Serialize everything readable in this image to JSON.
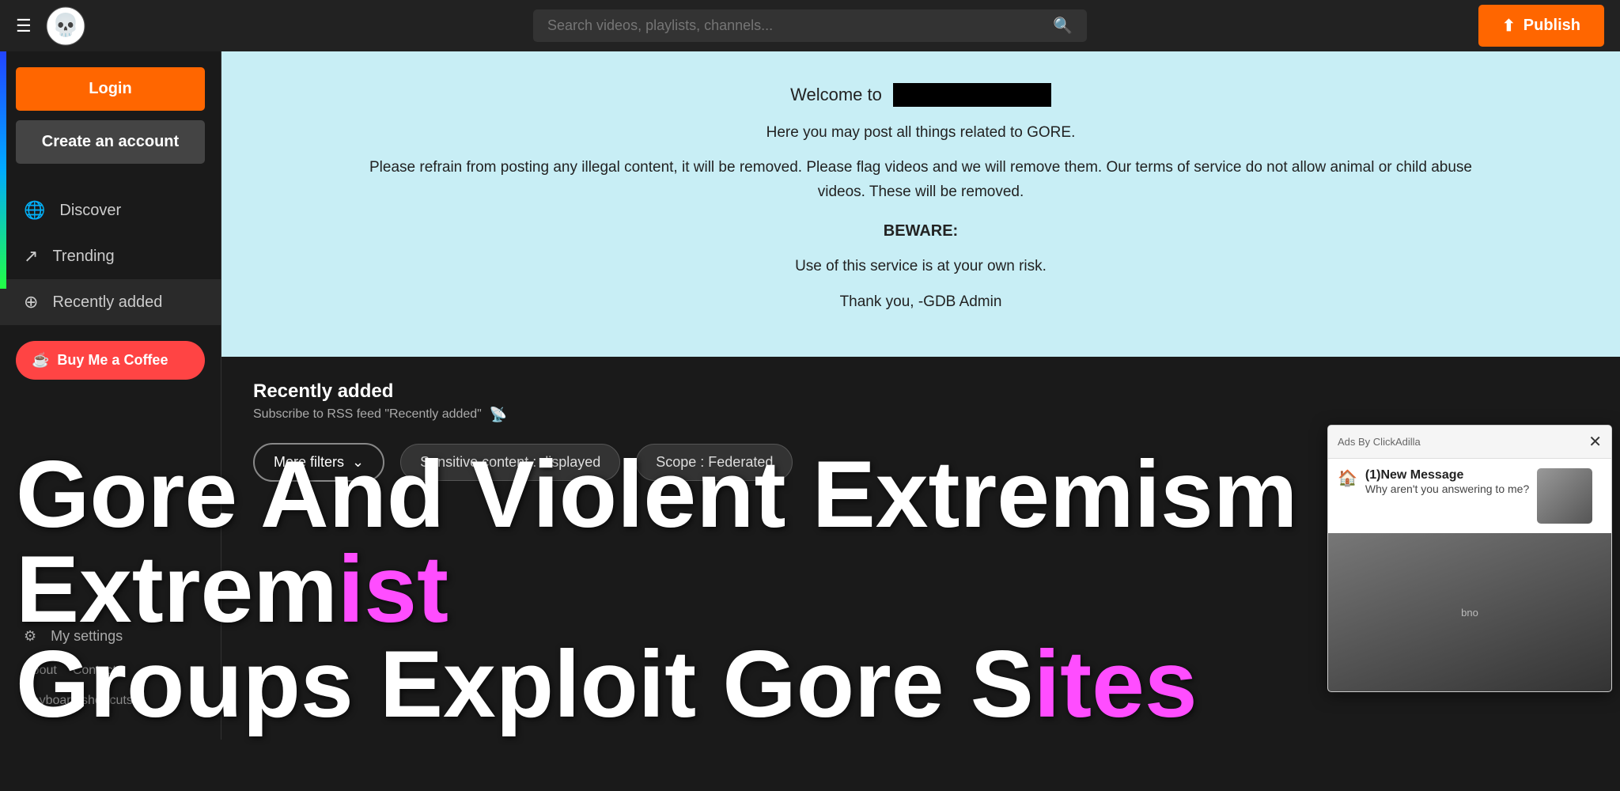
{
  "header": {
    "menu_icon": "☰",
    "logo_alt": "skull logo",
    "search_placeholder": "Search videos, playlists, channels...",
    "publish_label": "Publish",
    "publish_icon": "↑"
  },
  "sidebar": {
    "login_label": "Login",
    "create_account_label": "Create an account",
    "nav_items": [
      {
        "id": "discover",
        "label": "Discover",
        "icon": "🌐"
      },
      {
        "id": "trending",
        "label": "Trending",
        "icon": "↗"
      },
      {
        "id": "recently-added",
        "label": "Recently added",
        "icon": "⊕"
      }
    ],
    "buy_coffee_label": "Buy Me a Coffee",
    "bottom_items": [
      {
        "id": "my-settings",
        "label": "My settings",
        "icon": "⚙"
      },
      {
        "id": "about",
        "label": "About"
      },
      {
        "id": "contact",
        "label": "Contact"
      },
      {
        "id": "keyboard-shortcuts",
        "label": "Keyboard shortcuts"
      }
    ]
  },
  "welcome": {
    "title_prefix": "Welcome to",
    "line2": "Here you may post all things related to GORE.",
    "line3": "Please refrain from posting any illegal content, it will be removed. Please flag videos and we will remove them. Our terms of service do not allow animal or child abuse videos. These will be removed.",
    "beware": "BEWARE:",
    "risk": "Use of this service is at your own risk.",
    "thanks": "Thank you, -GDB Admin"
  },
  "recently_section": {
    "title": "Recently added",
    "rss_sub": "Subscribe to RSS feed \"Recently added\"",
    "rss_icon": "📡",
    "filters": {
      "more_filters_label": "More filters",
      "chevron": "⌄",
      "sensitive_label": "Sensitive content : displayed",
      "scope_label": "Scope : Federated"
    }
  },
  "overlay": {
    "line1": "Gore And Violent Extremism How Extrem",
    "line1_highlight": "ist",
    "line2": "Groups Exploit Gore S",
    "line2_highlight": "ites"
  },
  "ad_popup": {
    "ads_label": "Ads By ClickAdilla",
    "close_icon": "✕",
    "message_icon": "🏠",
    "new_message": "(1)New Message",
    "sub_text": "Why aren't you answering to me?",
    "bno": "bno"
  }
}
